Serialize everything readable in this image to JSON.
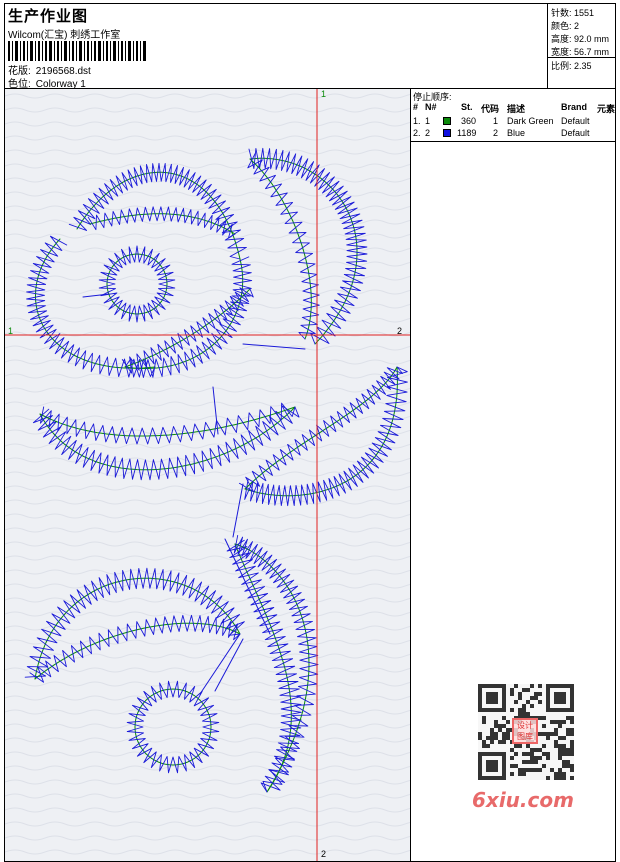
{
  "header": {
    "title": "生产作业图",
    "company": "Wilcom(汇宝) 刺绣工作室",
    "design_label": "花版:",
    "design_value": "2196568.dst",
    "colorway_label": "色位:",
    "colorway_value": "Colorway 1"
  },
  "stats": {
    "stitches": "针数: 1551",
    "colors": "颜色: 2",
    "height": "高度: 92.0 mm",
    "width": "宽度: 56.7 mm",
    "ratio": "比例: 2.35"
  },
  "axis_labels": {
    "top": "1",
    "bottom": "2",
    "right": "2",
    "left": "1"
  },
  "stop_sequence": {
    "title": "停止顺序:",
    "headers": [
      "#",
      "N#",
      "St.",
      "代码",
      "描述",
      "Brand",
      "元素"
    ],
    "rows": [
      {
        "idx": "1.",
        "n": "1",
        "color": "#0a8a0a",
        "st": "360",
        "code": "1",
        "desc": "Dark Green",
        "brand": "Default"
      },
      {
        "idx": "2.",
        "n": "2",
        "color": "#1010e0",
        "st": "1189",
        "code": "2",
        "desc": "Blue",
        "brand": "Default"
      }
    ]
  },
  "watermark": {
    "text": "6xiu.com",
    "seal": "设计图库"
  },
  "colors": {
    "green": "#0a8a0a",
    "blue": "#1a1ad8",
    "crosshair": "#e02020"
  }
}
